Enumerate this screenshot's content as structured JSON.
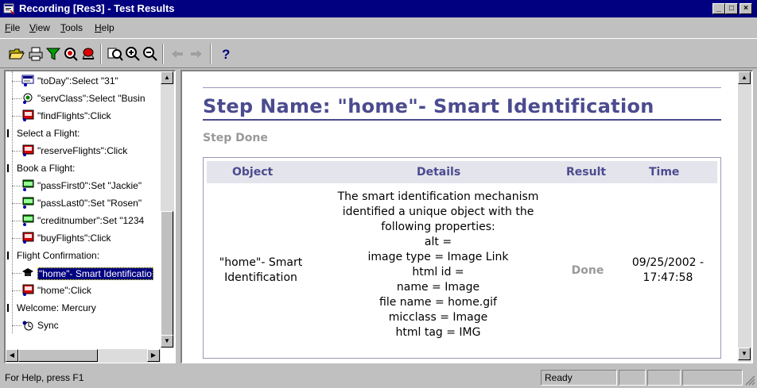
{
  "window": {
    "title": "Recording [Res3] - Test Results",
    "buttons": {
      "minimize": "_",
      "maximize": "□",
      "close": "×"
    }
  },
  "menu": [
    {
      "key": "F",
      "rest": "ile"
    },
    {
      "key": "V",
      "rest": "iew"
    },
    {
      "key": "T",
      "rest": "ools"
    },
    {
      "key": "H",
      "rest": "elp"
    }
  ],
  "toolbar": {
    "icons": [
      "open-folder-icon",
      "print-icon",
      "filter-icon",
      "find-icon",
      "bug-icon",
      "zoom-fit-icon",
      "zoom-in-icon",
      "zoom-out-icon",
      "back-arrow-icon",
      "forward-arrow-icon",
      "help-icon"
    ],
    "help_label": "?"
  },
  "tree": [
    {
      "label": "\"toDay\":Select \"31\"",
      "icon": "listbox-icon",
      "indent": 1
    },
    {
      "label": "\"servClass\":Select \"Busin",
      "icon": "radio-icon",
      "indent": 1
    },
    {
      "label": "\"findFlights\":Click",
      "icon": "image-button-icon",
      "indent": 1
    },
    {
      "label": "Select a Flight:",
      "icon": "",
      "indent": 0
    },
    {
      "label": "\"reserveFlights\":Click",
      "icon": "image-button-icon",
      "indent": 1
    },
    {
      "label": "Book a Flight:",
      "icon": "",
      "indent": 0
    },
    {
      "label": "\"passFirst0\":Set \"Jackie\"",
      "icon": "edit-field-icon",
      "indent": 1
    },
    {
      "label": "\"passLast0\":Set \"Rosen\"",
      "icon": "edit-field-icon",
      "indent": 1
    },
    {
      "label": "\"creditnumber\":Set \"1234",
      "icon": "edit-field-icon",
      "indent": 1
    },
    {
      "label": "\"buyFlights\":Click",
      "icon": "image-button-icon",
      "indent": 1
    },
    {
      "label": "Flight Confirmation:",
      "icon": "",
      "indent": 0
    },
    {
      "label": "\"home\"- Smart Identificatio",
      "icon": "graduation-cap-icon",
      "indent": 1,
      "selected": true
    },
    {
      "label": "\"home\":Click",
      "icon": "image-button-icon",
      "indent": 1
    },
    {
      "label": "Welcome: Mercury",
      "icon": "",
      "indent": 0
    },
    {
      "label": "Sync",
      "icon": "sync-icon",
      "indent": 1
    }
  ],
  "report": {
    "step_title": "Step Name: \"home\"- Smart Identification",
    "step_status": "Step Done",
    "table": {
      "headers": {
        "object": "Object",
        "details": "Details",
        "result": "Result",
        "time": "Time"
      },
      "row": {
        "object_lines": [
          "\"home\"- Smart",
          "Identification"
        ],
        "details_lines": [
          "The smart identification mechanism",
          "identified a unique object with the",
          "following properties:",
          "alt =",
          "image type = Image Link",
          "html id =",
          "name = Image",
          "file name = home.gif",
          "micclass = Image",
          "html tag = IMG"
        ],
        "result": "Done",
        "time_lines": [
          "09/25/2002 -",
          "17:47:58"
        ]
      }
    }
  },
  "status": {
    "help": "For Help, press F1",
    "state": "Ready"
  },
  "colors": {
    "titlebar": "#000080",
    "heading": "#4b4b8f",
    "muted": "#999999",
    "selection": "#000080"
  }
}
